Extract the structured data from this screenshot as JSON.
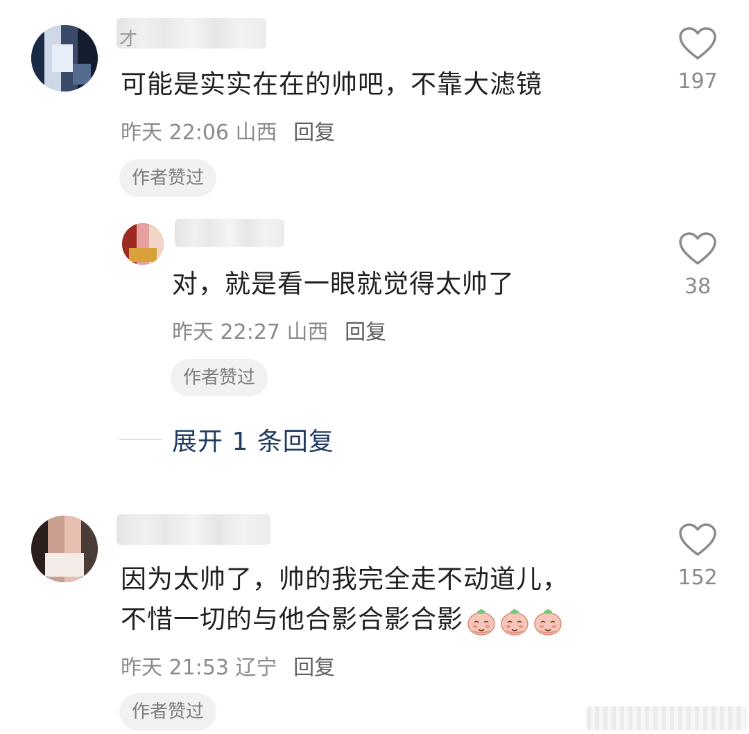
{
  "comments": [
    {
      "username_visible": "才",
      "text": "可能是实实在在的帅吧，不靠大滤镜",
      "time": "昨天 22:06",
      "location": "山西",
      "reply_label": "回复",
      "badge": "作者赞过",
      "likes": "197",
      "replies": [
        {
          "text": "对，就是看一眼就觉得太帅了",
          "time": "昨天 22:27",
          "location": "山西",
          "reply_label": "回复",
          "badge": "作者赞过",
          "likes": "38"
        }
      ],
      "expand_label": "展开 1 条回复"
    },
    {
      "text_line1": "因为太帅了，帅的我完全走不动道儿，",
      "text_line2": "不惜一切的与他合影合影合影",
      "emoji_count": 3,
      "emoji_name": "peach-shy-emoji",
      "time": "昨天 21:53",
      "location": "辽宁",
      "reply_label": "回复",
      "badge": "作者赞过",
      "likes": "152"
    }
  ],
  "icons": {
    "like": "heart-outline-icon"
  },
  "colors": {
    "text": "#202020",
    "meta": "#8a8a8a",
    "badge_bg": "#f1f1f1",
    "expand_link": "#1f3b63"
  }
}
